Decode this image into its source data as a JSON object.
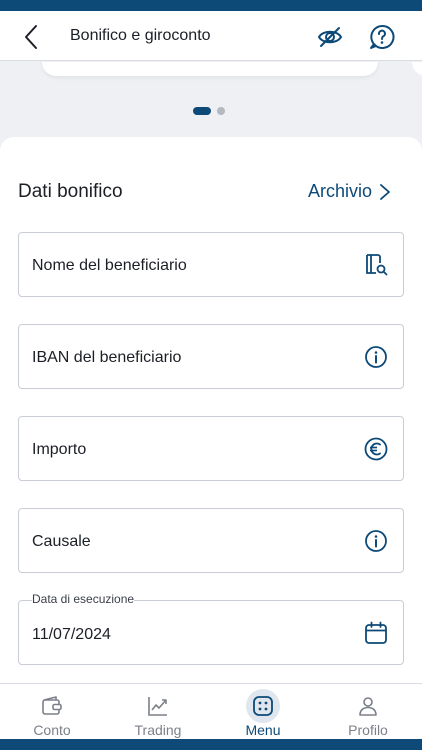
{
  "header": {
    "title": "Bonifico e giroconto"
  },
  "carousel": {
    "active_index": 0,
    "page_count": 2
  },
  "form": {
    "section_title": "Dati bonifico",
    "archive_link": "Archivio",
    "fields": {
      "beneficiary_name": "Nome del beneficiario",
      "beneficiary_iban": "IBAN del beneficiario",
      "amount": "Importo",
      "reason": "Causale",
      "execution_date_label": "Data di esecuzione",
      "execution_date_value": "11/07/2024"
    }
  },
  "tabs": [
    {
      "label": "Conto",
      "icon": "wallet-icon",
      "active": false
    },
    {
      "label": "Trading",
      "icon": "chart-trend-icon",
      "active": false
    },
    {
      "label": "Menu",
      "icon": "menu-grid-icon",
      "active": true
    },
    {
      "label": "Profilo",
      "icon": "person-icon",
      "active": false
    }
  ],
  "colors": {
    "brand": "#0d4a78",
    "inactive": "#7b8089",
    "border": "#c9ced6"
  }
}
